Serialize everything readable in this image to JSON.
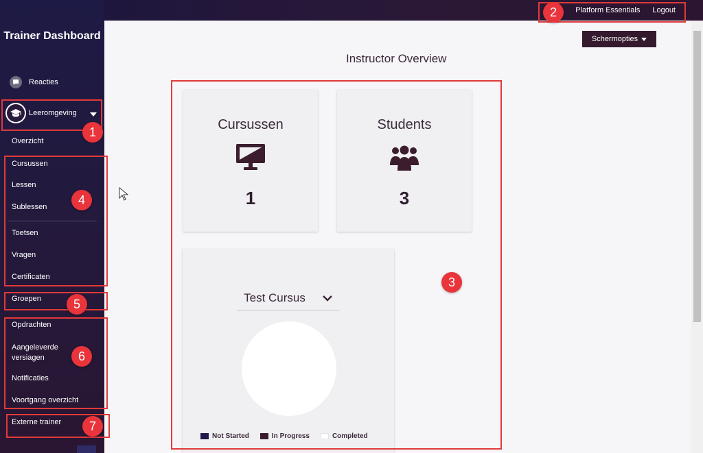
{
  "sidebar": {
    "brand": "Trainer Dashboard",
    "reacties": "Reacties",
    "leeromgeving": "Leeromgeving",
    "items": {
      "overzicht": "Overzicht",
      "cursussen": "Cursussen",
      "lessen": "Lessen",
      "sublessen": "Sublessen",
      "toetsen": "Toetsen",
      "vragen": "Vragen",
      "certificaten": "Certificaten",
      "groepen": "Groepen",
      "opdrachten": "Opdrachten",
      "aangeleverde_versiagen": "Aangeleverde versiagen",
      "notificaties": "Notificaties",
      "voortgang": "Voortgang overzicht",
      "externe_trainer": "Externe trainer"
    }
  },
  "topbar": {
    "platform_essentials": "Platform Essentials",
    "logout": "Logout"
  },
  "main": {
    "schermopties": "Schermopties",
    "title": "Instructor Overview",
    "cards": {
      "cursussen": {
        "label": "Cursussen",
        "value": "1",
        "icon": "monitor-icon"
      },
      "students": {
        "label": "Students",
        "value": "3",
        "icon": "users-icon"
      }
    },
    "course_select": "Test Cursus",
    "legend": [
      {
        "label": "Not Started",
        "color": "#1f1a4a"
      },
      {
        "label": "In Progress",
        "color": "#3a1a2e"
      },
      {
        "label": "Completed",
        "color": "#ffffff"
      }
    ]
  },
  "annotations": [
    "1",
    "2",
    "3",
    "4",
    "5",
    "6",
    "7"
  ],
  "colors": {
    "accent": "#351a2e",
    "annotation_red": "#e8343a"
  }
}
